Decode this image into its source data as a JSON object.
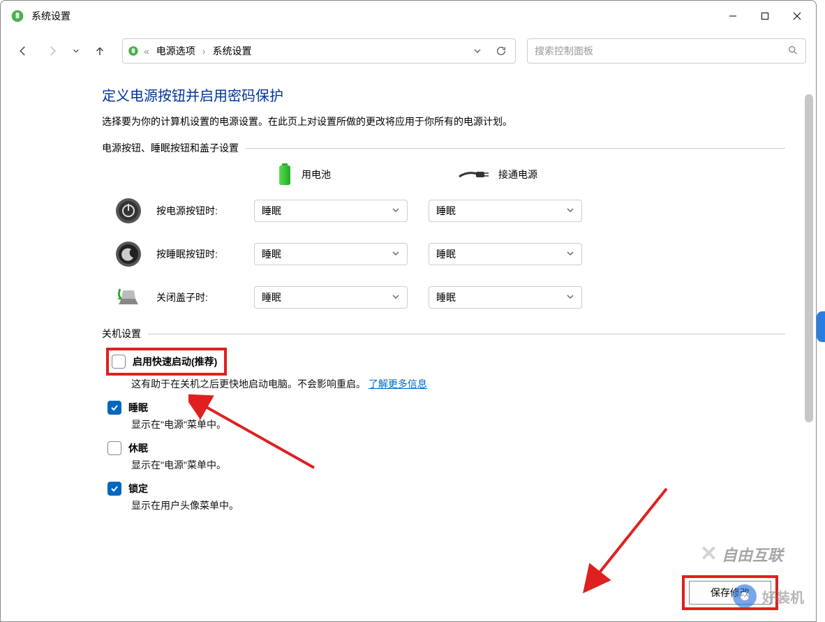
{
  "window": {
    "title": "系统设置"
  },
  "breadcrumb": {
    "parent": "电源选项",
    "current": "系统设置"
  },
  "search": {
    "placeholder": "搜索控制面板"
  },
  "main": {
    "title": "定义电源按钮并启用密码保护",
    "description": "选择要为你的计算机设置的电源设置。在此页上对设置所做的更改将应用于你所有的电源计划。"
  },
  "buttons_section": {
    "label": "电源按钮、睡眠按钮和盖子设置",
    "col_battery": "用电池",
    "col_plugged": "接通电源",
    "rows": [
      {
        "label": "按电源按钮时:",
        "battery": "睡眠",
        "plugged": "睡眠"
      },
      {
        "label": "按睡眠按钮时:",
        "battery": "睡眠",
        "plugged": "睡眠"
      },
      {
        "label": "关闭盖子时:",
        "battery": "睡眠",
        "plugged": "睡眠"
      }
    ]
  },
  "shutdown_section": {
    "label": "关机设置",
    "fast_startup": {
      "label": "启用快速启动(推荐)",
      "desc_prefix": "这有助于在关机之后更快地启动电脑。不会影响重启。",
      "link": "了解更多信息"
    },
    "sleep": {
      "label": "睡眠",
      "desc": "显示在\"电源\"菜单中。"
    },
    "hibernate": {
      "label": "休眠",
      "desc": "显示在\"电源\"菜单中。"
    },
    "lock": {
      "label": "锁定",
      "desc": "显示在用户头像菜单中。"
    }
  },
  "footer": {
    "save": "保存修改"
  },
  "watermarks": {
    "w1": "自由互联",
    "w2": "好装机"
  }
}
